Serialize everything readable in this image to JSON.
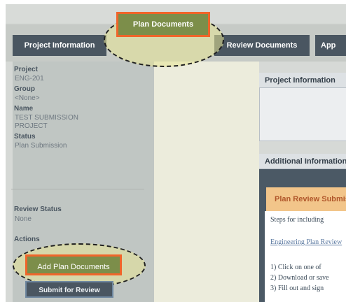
{
  "tabs": [
    {
      "label": "Project Information"
    },
    {
      "label": "Plan Documents"
    },
    {
      "label": "Review Documents"
    },
    {
      "label": "App"
    }
  ],
  "sidebar": {
    "project_label": "Project",
    "project_value": "ENG-201",
    "group_label": "Group",
    "group_value": "<None>",
    "name_label": "Name",
    "name_value": "TEST SUBMISSION PROJECT",
    "status_label": "Status",
    "status_value": "Plan Submission",
    "review_status_label": "Review Status",
    "review_status_value": "None",
    "actions_label": "Actions",
    "add_button": "Add Plan Documents",
    "submit_button": "Submit for Review"
  },
  "main": {
    "panel1_title": "Project Information",
    "panel2_title": "Additional Information",
    "plan_review_header": "Plan Review Submission",
    "steps_text": "Steps for including",
    "link_text": "Engineering Plan Review",
    "step1": "1) Click on one of",
    "step2": "2) Download or save",
    "step3": "3) Fill out and sign"
  }
}
